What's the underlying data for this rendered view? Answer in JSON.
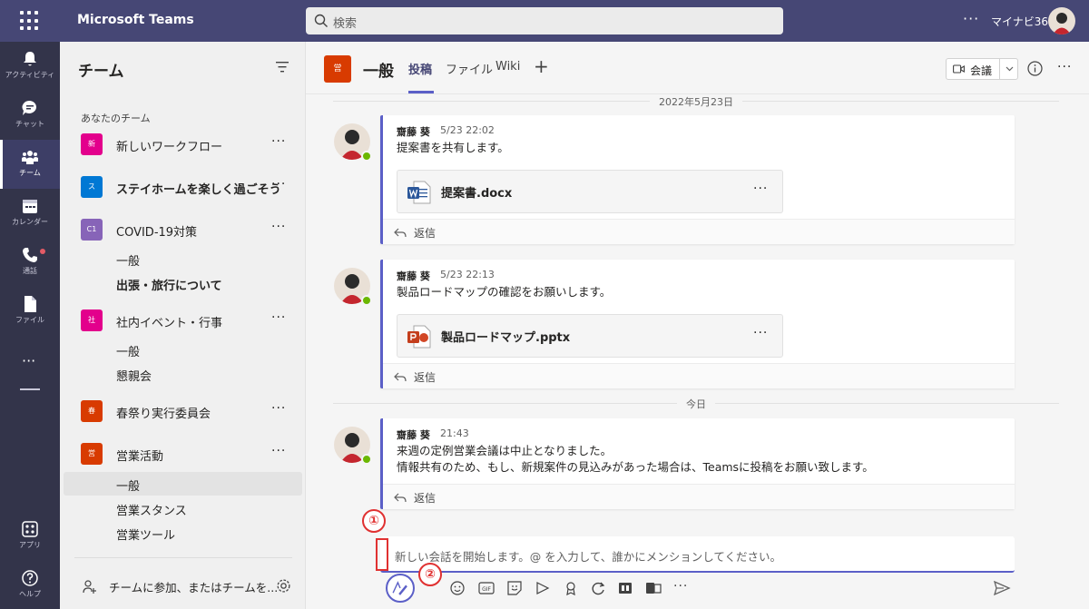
{
  "app": {
    "title": "Microsoft Teams",
    "search_placeholder": "検索",
    "more": "···",
    "user": "マイナビ365"
  },
  "rail": {
    "items": [
      {
        "label": "アクティビティ"
      },
      {
        "label": "チャット"
      },
      {
        "label": "チーム"
      },
      {
        "label": "カレンダー"
      },
      {
        "label": "通話"
      },
      {
        "label": "ファイル"
      },
      {
        "label": "アプリ"
      },
      {
        "label": "ヘルプ"
      }
    ],
    "more": "···"
  },
  "teams_panel": {
    "title": "チーム",
    "section": "あなたのチーム",
    "teams": [
      {
        "tile": "新",
        "color": "#e3008c",
        "name": "新しいワークフロー",
        "bold": false
      },
      {
        "tile": "ス",
        "color": "#0078d4",
        "name": "ステイホームを楽しく過ごそう",
        "bold": true
      },
      {
        "tile": "C1",
        "color": "#8764b8",
        "name": "COVID-19対策",
        "bold": false,
        "channels": [
          "一般",
          "出張・旅行について"
        ]
      },
      {
        "tile": "社",
        "color": "#e3008c",
        "name": "社内イベント・行事",
        "bold": false,
        "channels": [
          "一般",
          "懇親会"
        ]
      },
      {
        "tile": "春",
        "color": "#d83b01",
        "name": "春祭り実行委員会",
        "bold": false
      },
      {
        "tile": "営",
        "color": "#d83b01",
        "name": "営業活動",
        "bold": false,
        "channels": [
          "一般",
          "営業スタンス",
          "営業ツール"
        ]
      }
    ],
    "more": "···",
    "join_label": "チームに参加、またはチームを..."
  },
  "channel": {
    "tile": "営",
    "name": "一般",
    "tabs": [
      "投稿",
      "ファイル",
      "Wiki"
    ],
    "add_tab": "+",
    "meet_label": "会議",
    "more": "···"
  },
  "feed": {
    "date1": "2022年5月23日",
    "date2": "今日",
    "messages": [
      {
        "author": "齋藤 葵",
        "time": "5/23 22:02",
        "body": [
          "提案書を共有します。"
        ],
        "attachment": {
          "name": "提案書.docx",
          "type": "word"
        }
      },
      {
        "author": "齋藤 葵",
        "time": "5/23 22:13",
        "body": [
          "製品ロードマップの確認をお願いします。"
        ],
        "attachment": {
          "name": "製品ロードマップ.pptx",
          "type": "powerpoint"
        }
      },
      {
        "author": "齋藤 葵",
        "time": "21:43",
        "body": [
          "来週の定例営業会議は中止となりました。",
          "情報共有のため、もし、新規案件の見込みがあった場合は、Teamsに投稿をお願い致します。"
        ]
      }
    ],
    "reply_label": "返信",
    "attachment_more": "···"
  },
  "compose": {
    "placeholder": "新しい会話を開始します。@ を入力して、誰かにメンションしてください。",
    "toolbar_more": "···"
  },
  "annotations": {
    "callout1": "①",
    "callout2": "②",
    "color": "#e03131"
  },
  "colors": {
    "topbar": "#464775",
    "rail": "#33344a",
    "accent": "#5b5fc7",
    "presence": "#6bb700"
  }
}
